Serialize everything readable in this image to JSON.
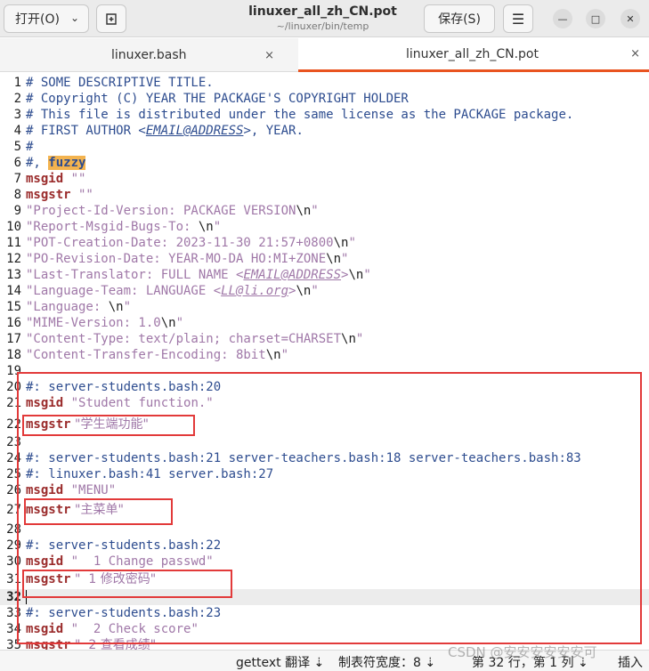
{
  "header": {
    "open_label": "打开(O)",
    "title": "linuxer_all_zh_CN.pot",
    "subtitle": "~/linuxer/bin/temp",
    "save_label": "保存(S)"
  },
  "tabs": [
    {
      "label": "linuxer.bash",
      "close": "×"
    },
    {
      "label": "linuxer_all_zh_CN.pot",
      "close": "×"
    }
  ],
  "lines": [
    {
      "n": "1",
      "t": "# SOME DESCRIPTIVE TITLE."
    },
    {
      "n": "2",
      "t": "# Copyright (C) YEAR THE PACKAGE'S COPYRIGHT HOLDER"
    },
    {
      "n": "3",
      "t": "# This file is distributed under the same license as the PACKAGE package."
    },
    {
      "n": "4",
      "a": "# FIRST AUTHOR <",
      "e": "EMAIL@ADDRESS",
      "b": ">, YEAR."
    },
    {
      "n": "5",
      "t": "#"
    },
    {
      "n": "6",
      "a": "#, ",
      "f": "fuzzy"
    },
    {
      "n": "7",
      "k": "msgid",
      "s": " \"\""
    },
    {
      "n": "8",
      "k": "msgstr",
      "s": " \"\""
    },
    {
      "n": "9",
      "s": "\"Project-Id-Version: PACKAGE VERSION",
      "x": "\\n",
      "q": "\""
    },
    {
      "n": "10",
      "s": "\"Report-Msgid-Bugs-To: ",
      "x": "\\n",
      "q": "\""
    },
    {
      "n": "11",
      "s": "\"POT-Creation-Date: 2023-11-30 21:57+0800",
      "x": "\\n",
      "q": "\""
    },
    {
      "n": "12",
      "s": "\"PO-Revision-Date: YEAR-MO-DA HO:MI+ZONE",
      "x": "\\n",
      "q": "\""
    },
    {
      "n": "13",
      "s": "\"Last-Translator: FULL NAME <",
      "se": "EMAIL@ADDRESS",
      "s2": ">",
      "x": "\\n",
      "q": "\""
    },
    {
      "n": "14",
      "s": "\"Language-Team: LANGUAGE <",
      "se": "LL@li.org",
      "s2": ">",
      "x": "\\n",
      "q": "\""
    },
    {
      "n": "15",
      "s": "\"Language: ",
      "x": "\\n",
      "q": "\""
    },
    {
      "n": "16",
      "s": "\"MIME-Version: 1.0",
      "x": "\\n",
      "q": "\""
    },
    {
      "n": "17",
      "s": "\"Content-Type: text/plain; charset=CHARSET",
      "x": "\\n",
      "q": "\""
    },
    {
      "n": "18",
      "s": "\"Content-Transfer-Encoding: 8bit",
      "x": "\\n",
      "q": "\""
    },
    {
      "n": "19"
    },
    {
      "n": "20",
      "t": "#: server-students.bash:20"
    },
    {
      "n": "21",
      "k": "msgid",
      "s": " \"Student function.\""
    },
    {
      "n": "22",
      "k": "msgstr",
      "s": " \"学生端功能\""
    },
    {
      "n": "23"
    },
    {
      "n": "24",
      "t": "#: server-students.bash:21 server-teachers.bash:18 server-teachers.bash:83"
    },
    {
      "n": "25",
      "t": "#: linuxer.bash:41 server.bash:27"
    },
    {
      "n": "26",
      "k": "msgid",
      "s": " \"MENU\""
    },
    {
      "n": "27",
      "k": "msgstr",
      "s": " \"主菜单\""
    },
    {
      "n": "28"
    },
    {
      "n": "29",
      "t": "#: server-students.bash:22"
    },
    {
      "n": "30",
      "k": "msgid",
      "s": " \"  1 Change passwd\""
    },
    {
      "n": "31",
      "k": "msgstr",
      "s": " \"  1 修改密码\""
    },
    {
      "n": "32",
      "cur": true
    },
    {
      "n": "33",
      "t": "#: server-students.bash:23"
    },
    {
      "n": "34",
      "k": "msgid",
      "s": " \"  2 Check score\""
    },
    {
      "n": "35",
      "k": "msgstr",
      "s": " \"  2 查看成绩\""
    }
  ],
  "status": {
    "language": "gettext 翻译 ⇣",
    "tab_width": "制表符宽度：8 ⇣",
    "position": "第 32 行，第 1 列 ⇣",
    "mode": "插入"
  },
  "watermark": "CSDN @安安安安安安可"
}
